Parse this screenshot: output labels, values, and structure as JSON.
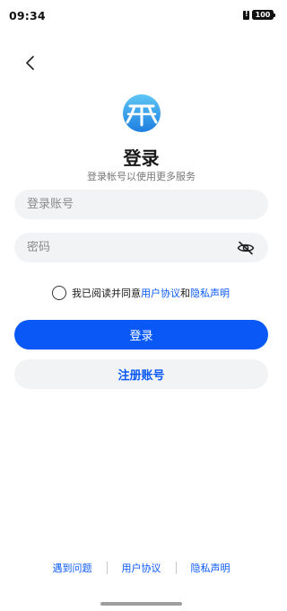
{
  "status_bar": {
    "time": "09:34",
    "battery": "100"
  },
  "header": {
    "back_icon": "chevron-left-icon"
  },
  "logo": {
    "icon": "app-logo-icon",
    "colors": {
      "top": "#5fc6f5",
      "bottom": "#1d7fe0"
    }
  },
  "page": {
    "title": "登录",
    "subtitle": "登录帐号以使用更多服务"
  },
  "form": {
    "account_placeholder": "登录账号",
    "account_value": "",
    "password_placeholder": "密码",
    "password_value": "",
    "eye_icon": "eye-off-icon"
  },
  "agreement": {
    "checked": false,
    "prefix": "我已阅读并同意",
    "user_agreement": "用户协议",
    "and": "和",
    "privacy": "隐私声明"
  },
  "buttons": {
    "login": "登录",
    "register": "注册账号"
  },
  "footer": {
    "problem": "遇到问题",
    "user_agreement": "用户协议",
    "privacy": "隐私声明"
  },
  "colors": {
    "accent": "#0a59f7",
    "field_bg": "#f1f3f5"
  }
}
